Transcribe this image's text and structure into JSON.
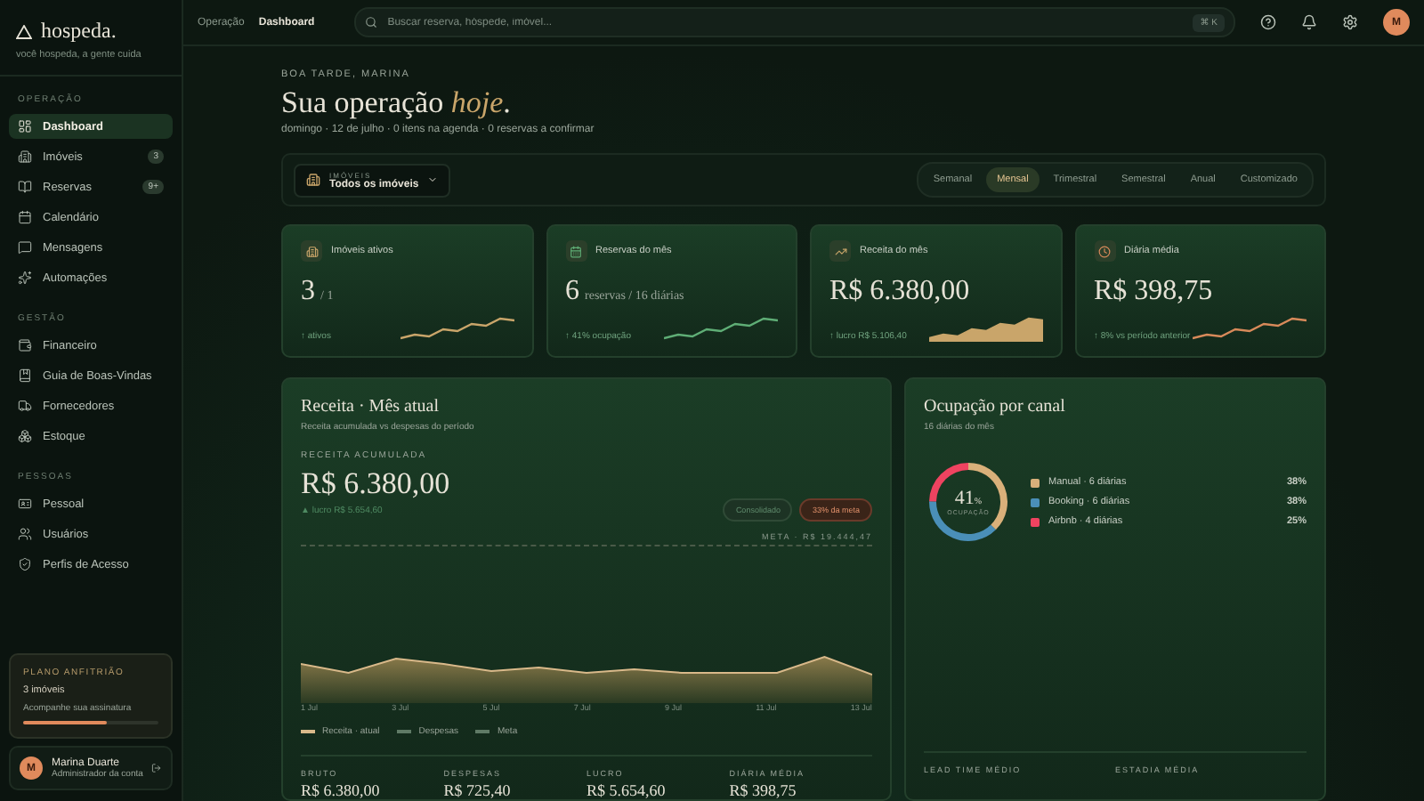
{
  "brand": {
    "name": "hospeda.",
    "tagline": "você hospeda, a gente cuida"
  },
  "sidebar": {
    "sections": [
      {
        "title": "OPERAÇÃO",
        "items": [
          {
            "label": "Dashboard",
            "selected": true
          },
          {
            "label": "Imóveis",
            "selected": false,
            "badge": "3"
          },
          {
            "label": "Reservas",
            "selected": false,
            "badge": "9+"
          },
          {
            "label": "Calendário",
            "selected": false
          },
          {
            "label": "Mensagens",
            "selected": false
          },
          {
            "label": "Automações",
            "selected": false
          }
        ]
      },
      {
        "title": "GESTÃO",
        "items": [
          {
            "label": "Financeiro",
            "selected": false
          },
          {
            "label": "Guia de Boas-Vindas",
            "selected": false
          },
          {
            "label": "Fornecedores",
            "selected": false
          },
          {
            "label": "Estoque",
            "selected": false
          }
        ]
      },
      {
        "title": "PESSOAS",
        "items": [
          {
            "label": "Pessoal",
            "selected": false
          },
          {
            "label": "Usuários",
            "selected": false
          },
          {
            "label": "Perfis de Acesso",
            "selected": false
          }
        ]
      }
    ]
  },
  "plan": {
    "title": "PLANO ANFITRIÃO",
    "usage": "3 imóveis",
    "hint": "Acompanhe sua assinatura",
    "level": 0.62
  },
  "user": {
    "initial": "M",
    "name": "Marina Duarte",
    "role": "Administrador da conta"
  },
  "topbar": {
    "breadcrumb": [
      {
        "label": "Operação",
        "selected": false
      },
      {
        "label": "Dashboard",
        "selected": true
      }
    ],
    "search": {
      "placeholder": "Buscar reserva, hóspede, imóvel..."
    },
    "shortcut": "⌘ K",
    "avatar": "M"
  },
  "greeting": {
    "eyebrow": "BOA TARDE, MARINA",
    "title": "Sua operação ",
    "accent": "hoje",
    "end": ".",
    "subtitle": "domingo · 12 de julho · 0 itens na agenda · 0 reservas a confirmar"
  },
  "filter": {
    "label": "IMÓVEIS",
    "value": "Todos os imóveis"
  },
  "periods": [
    {
      "label": "Semanal",
      "selected": false
    },
    {
      "label": "Mensal",
      "selected": true
    },
    {
      "label": "Trimestral",
      "selected": false
    },
    {
      "label": "Semestral",
      "selected": false
    },
    {
      "label": "Anual",
      "selected": false
    },
    {
      "label": "Customizado",
      "selected": false
    }
  ],
  "kpis": [
    {
      "title": "Imóveis ativos",
      "value": "3",
      "unit": "/ 1",
      "footer": "↑ ativos",
      "kind": "line",
      "color": "#c9a56a"
    },
    {
      "title": "Reservas do mês",
      "value": "6",
      "unit": "reservas / 16 diárias",
      "footer": "↑ 41% ocupação",
      "kind": "line",
      "color": "#5fae76"
    },
    {
      "title": "Receita do mês",
      "value": "R$ 6.380,00",
      "footer": "↑ lucro R$ 5.106,40",
      "kind": "area",
      "color": "#c9a56a"
    },
    {
      "title": "Diária média",
      "value": "R$ 398,75",
      "footer": "↑ 8% vs período anterior",
      "kind": "line",
      "color": "#d88a5a"
    }
  ],
  "revenue": {
    "title": "Receita · Mês atual",
    "subtitle": "Receita acumulada vs despesas do período",
    "eyebrow": "RECEITA ACUMULADA",
    "value": "R$ 6.380,00",
    "delta": "▲ lucro R$ 5.654,60",
    "chips": [
      {
        "label": "Consolidado",
        "kind": "neutral"
      },
      {
        "label": "33% da meta",
        "kind": "alert"
      }
    ],
    "goal": "META · R$ 19.444,47",
    "x_labels": [
      "1 Jul",
      "3 Jul",
      "5 Jul",
      "7 Jul",
      "9 Jul",
      "11 Jul",
      "13 Jul"
    ],
    "legend": [
      "Receita · atual",
      "Despesas",
      "Meta"
    ],
    "stats": [
      {
        "label": "BRUTO",
        "value": "R$ 6.380,00"
      },
      {
        "label": "DESPESAS",
        "value": "R$ 725,40"
      },
      {
        "label": "LUCRO",
        "value": "R$ 5.654,60"
      },
      {
        "label": "DIÁRIA MÉDIA",
        "value": "R$ 398,75"
      }
    ]
  },
  "occupancy": {
    "title": "Ocupação por canal",
    "subtitle": "16 diárias do mês",
    "center": "41",
    "center_unit": "%",
    "center_label": "OCUPAÇÃO",
    "chart_data": {
      "type": "donut",
      "categories": [
        "Manual",
        "Booking",
        "Airbnb"
      ],
      "values": [
        38,
        38,
        25
      ]
    },
    "legend": [
      {
        "detail": " · 6 diárias",
        "percent": "38%",
        "color": "#d9b07a"
      },
      {
        "detail": " · 6 diárias",
        "percent": "38%",
        "color": "#4a8fb8"
      },
      {
        "detail": " · 4 diárias",
        "percent": "25%",
        "color": "#ef4360"
      }
    ],
    "stats": [
      "LEAD TIME MÉDIO",
      "ESTADIA MÉDIA"
    ]
  }
}
